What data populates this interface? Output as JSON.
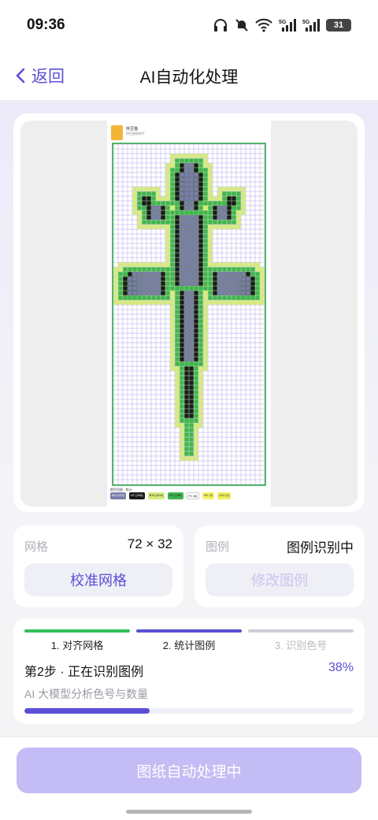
{
  "status": {
    "time": "09:36",
    "battery": "31"
  },
  "header": {
    "back_label": "返回",
    "title": "AI自动化处理"
  },
  "preview": {
    "brand": "拼豆猫",
    "subtitle": "拼豆图纸助手",
    "legend_caption": "颜色用量 · 统计",
    "legend": [
      {
        "label": "M3 (210)",
        "color": "#7b7fa8"
      },
      {
        "label": "H7 (206)",
        "color": "#1a1a1a"
      },
      {
        "label": "B16 (204)",
        "color": "#d6ec7a"
      },
      {
        "label": "B4 (186)",
        "color": "#3fb550"
      },
      {
        "label": "P1 (8)",
        "color": "#ffffff"
      },
      {
        "label": "B1 (3)",
        "color": "#f3f36a"
      },
      {
        "label": "A12 (1)",
        "color": "#f0f060"
      }
    ]
  },
  "grid_card": {
    "label": "网格",
    "value": "72 × 32",
    "button": "校准网格"
  },
  "legend_card": {
    "label": "图例",
    "value": "图例识别中",
    "button": "修改图例"
  },
  "progress": {
    "steps": [
      {
        "label": "1. 对齐网格",
        "state": "done"
      },
      {
        "label": "2. 统计图例",
        "state": "active"
      },
      {
        "label": "3. 识别色号",
        "state": "pending"
      }
    ],
    "title": "第2步 · 正在识别图例",
    "percent_label": "38%",
    "percent": 38,
    "description": "AI 大模型分析色号与数量"
  },
  "action": {
    "button": "图纸自动处理中"
  },
  "colors": {
    "accent": "#5b4fd6",
    "done": "#34c05a",
    "pending": "#cfcfd6"
  }
}
